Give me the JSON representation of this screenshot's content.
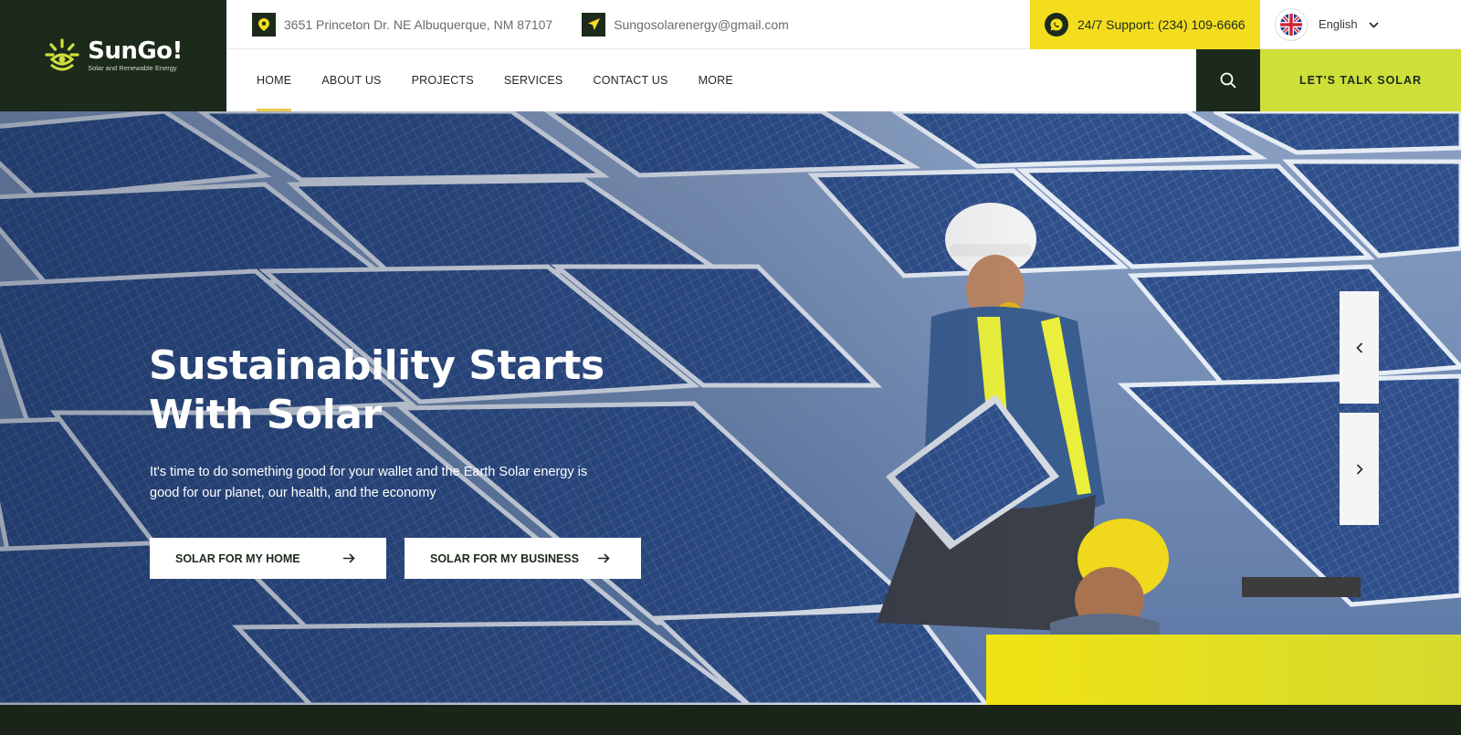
{
  "brand": {
    "name": "SunGo!",
    "tagline": "Solar and Renewable Energy",
    "dark_color": "#1c2a1b",
    "accent_lime": "#cfdf3a",
    "accent_yellow": "#f4dd1f"
  },
  "topbar": {
    "address": "3651 Princeton Dr. NE Albuquerque, NM 87107",
    "address_icon": "map-pin-icon",
    "email": "Sungosolarenergy@gmail.com",
    "email_icon": "send-icon",
    "support": "24/7 Support: (234) 109-6666",
    "support_icon": "whatsapp-icon",
    "language": "English",
    "language_icon": "uk-flag-icon"
  },
  "nav": {
    "items": [
      {
        "label": "HOME",
        "active": true
      },
      {
        "label": "ABOUT US",
        "active": false
      },
      {
        "label": "PROJECTS",
        "active": false
      },
      {
        "label": "SERVICES",
        "active": false
      },
      {
        "label": "CONTACT US",
        "active": false
      },
      {
        "label": "MORE",
        "active": false
      }
    ],
    "search_icon": "search-icon",
    "cta": "LET'S TALK SOLAR"
  },
  "hero": {
    "title_line1": "Sustainability Starts",
    "title_line2": "With Solar",
    "description": "It's time to do something good for your wallet and the Earth Solar energy is good for our planet, our health, and the economy",
    "button_home": "SOLAR FOR MY HOME",
    "button_business": "SOLAR FOR MY BUSINESS",
    "prev_icon": "chevron-left-icon",
    "next_icon": "chevron-right-icon"
  }
}
